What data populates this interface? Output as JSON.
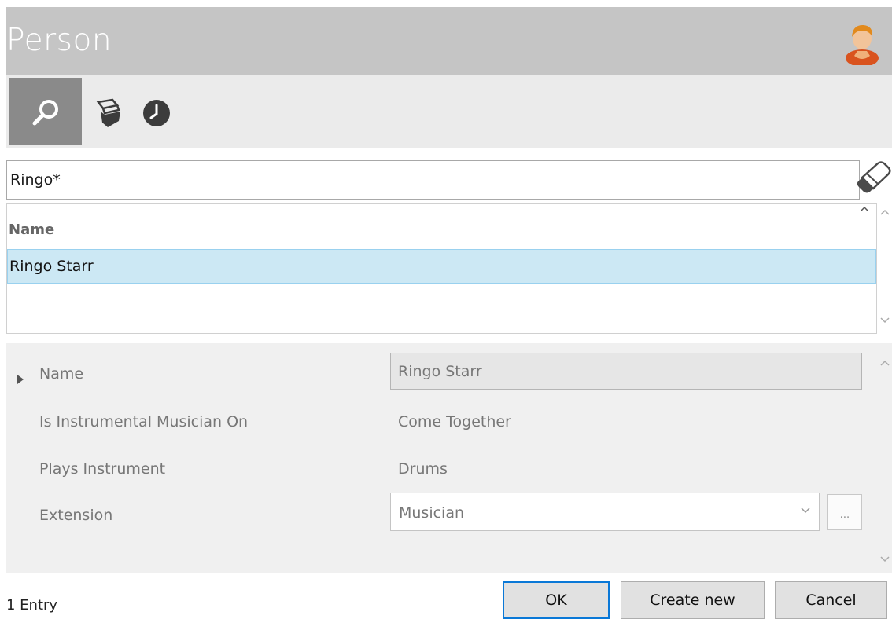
{
  "header": {
    "title": "Person",
    "icon": "person-avatar-icon"
  },
  "toolbar": {
    "items": [
      {
        "name": "search",
        "icon": "search-icon",
        "active": true
      },
      {
        "name": "open-box",
        "icon": "open-box-icon",
        "active": false
      },
      {
        "name": "history",
        "icon": "clock-icon",
        "active": false
      }
    ]
  },
  "search": {
    "value": "Ringo*",
    "clear_icon": "eraser-icon"
  },
  "results": {
    "column_header": "Name",
    "rows": [
      {
        "name": "Ringo Starr",
        "selected": true
      }
    ]
  },
  "details": {
    "fields": [
      {
        "label": "Name",
        "value": "Ringo Starr"
      },
      {
        "label": "Is Instrumental Musician On",
        "value": "Come Together"
      },
      {
        "label": "Plays Instrument",
        "value": "Drums"
      },
      {
        "label": "Extension",
        "value": "Musician"
      }
    ],
    "ellipsis_label": "..."
  },
  "footer": {
    "entry_count": "1 Entry",
    "ok_label": "OK",
    "create_label": "Create new",
    "cancel_label": "Cancel"
  },
  "colors": {
    "header_bg": "#c5c5c5",
    "toolbar_bg": "#ebebeb",
    "selection_bg": "#cce8f4",
    "primary_border": "#0a78d7"
  }
}
